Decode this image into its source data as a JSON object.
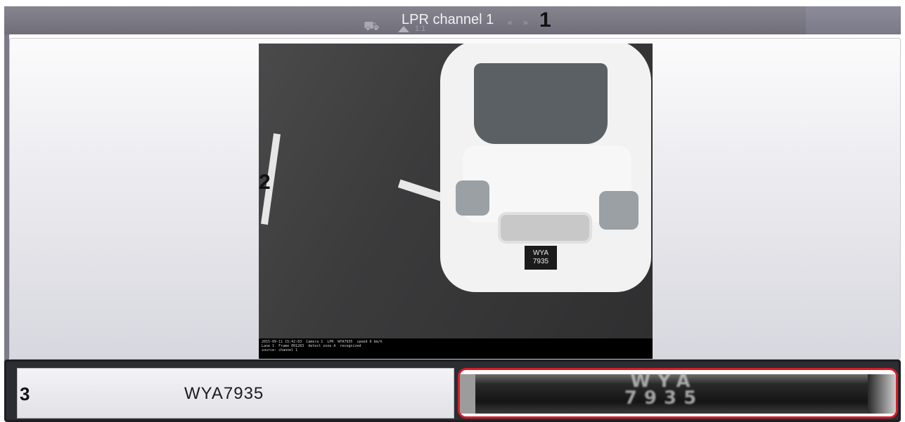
{
  "header": {
    "title": "LPR channel",
    "channel_number": "1",
    "ratio_label": "1:1",
    "controls": [
      "«",
      "»"
    ]
  },
  "annotations": {
    "marker_1": "1",
    "marker_2": "2",
    "marker_3": "3"
  },
  "video": {
    "plate_on_car": "WYA\n7935",
    "overlay_text": "2015-09-11 15:42:03  Camera 1  LPR  WYA7935  speed 0 km/h\nLane 1  Frame 001283  detect zone A  recognized\nsource: channel 1"
  },
  "result": {
    "plate_number": "WYA7935",
    "plate_image_text": "WYA\n7935",
    "highlight_color": "#d41e2a"
  },
  "icons": {
    "camera": "camera-icon",
    "arrow_up": "triangle-up-icon"
  }
}
